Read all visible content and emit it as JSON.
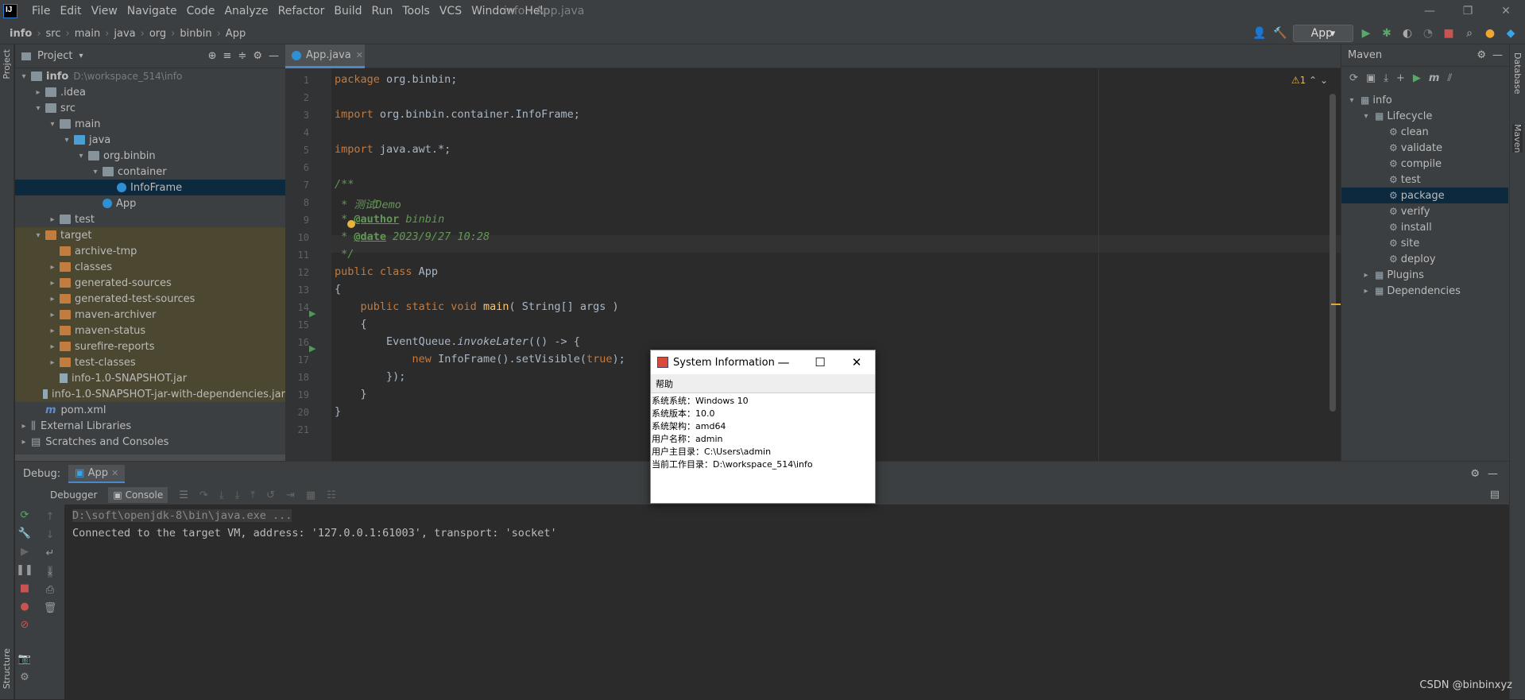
{
  "menubar": {
    "items": [
      "File",
      "Edit",
      "View",
      "Navigate",
      "Code",
      "Analyze",
      "Refactor",
      "Build",
      "Run",
      "Tools",
      "VCS",
      "Window",
      "Help"
    ],
    "window_title": "info - App.java"
  },
  "breadcrumb": {
    "items": [
      "info",
      "src",
      "main",
      "java",
      "org",
      "binbin",
      "App"
    ]
  },
  "toolbar": {
    "run_config": "App"
  },
  "project": {
    "title": "Project",
    "tree": [
      {
        "label": "info",
        "path": "D:\\workspace_514\\info",
        "indent": 0,
        "arrow": "▾",
        "icon": "folder"
      },
      {
        "label": ".idea",
        "indent": 1,
        "arrow": "▸",
        "icon": "folder"
      },
      {
        "label": "src",
        "indent": 1,
        "arrow": "▾",
        "icon": "folder"
      },
      {
        "label": "main",
        "indent": 2,
        "arrow": "▾",
        "icon": "folder"
      },
      {
        "label": "java",
        "indent": 3,
        "arrow": "▾",
        "icon": "folder blue"
      },
      {
        "label": "org.binbin",
        "indent": 4,
        "arrow": "▾",
        "icon": "folder"
      },
      {
        "label": "container",
        "indent": 5,
        "arrow": "▾",
        "icon": "folder"
      },
      {
        "label": "InfoFrame",
        "indent": 6,
        "arrow": "",
        "icon": "classic",
        "selected": true
      },
      {
        "label": "App",
        "indent": 5,
        "arrow": "",
        "icon": "classic"
      },
      {
        "label": "test",
        "indent": 2,
        "arrow": "▸",
        "icon": "folder"
      },
      {
        "label": "target",
        "indent": 1,
        "arrow": "▾",
        "icon": "folder orange",
        "target": true
      },
      {
        "label": "archive-tmp",
        "indent": 2,
        "arrow": "",
        "icon": "folder orange",
        "target": true
      },
      {
        "label": "classes",
        "indent": 2,
        "arrow": "▸",
        "icon": "folder orange",
        "target": true
      },
      {
        "label": "generated-sources",
        "indent": 2,
        "arrow": "▸",
        "icon": "folder orange",
        "target": true
      },
      {
        "label": "generated-test-sources",
        "indent": 2,
        "arrow": "▸",
        "icon": "folder orange",
        "target": true
      },
      {
        "label": "maven-archiver",
        "indent": 2,
        "arrow": "▸",
        "icon": "folder orange",
        "target": true
      },
      {
        "label": "maven-status",
        "indent": 2,
        "arrow": "▸",
        "icon": "folder orange",
        "target": true
      },
      {
        "label": "surefire-reports",
        "indent": 2,
        "arrow": "▸",
        "icon": "folder orange",
        "target": true
      },
      {
        "label": "test-classes",
        "indent": 2,
        "arrow": "▸",
        "icon": "folder orange",
        "target": true
      },
      {
        "label": "info-1.0-SNAPSHOT.jar",
        "indent": 2,
        "arrow": "",
        "icon": "jar",
        "target": true
      },
      {
        "label": "info-1.0-SNAPSHOT-jar-with-dependencies.jar",
        "indent": 2,
        "arrow": "",
        "icon": "jar",
        "target": true
      },
      {
        "label": "pom.xml",
        "indent": 1,
        "arrow": "",
        "icon": "mfile"
      },
      {
        "label": "External Libraries",
        "indent": 0,
        "arrow": "▸",
        "icon": "lib"
      },
      {
        "label": "Scratches and Consoles",
        "indent": 0,
        "arrow": "▸",
        "icon": "scratch"
      }
    ]
  },
  "editor": {
    "tab": "App.java",
    "warning": "⚠1",
    "lines": [
      "<span class=\"kw\">package</span> org.binbin;",
      "",
      "<span class=\"kw\">import</span> org.binbin.container.InfoFrame;",
      "",
      "<span class=\"kw\">import</span> java.awt.*;",
      "",
      "<span class=\"cm\">/**</span>",
      "<span class=\"cm\"> * 测试Demo</span>",
      "<span class=\"cm\"> * </span><span class=\"tag\">@author</span><span class=\"cm\"> binbin</span>",
      "<span class=\"cm\"> * </span><span class=\"tag\">@date</span><span class=\"cm\"> 2023/9/27 10:28</span>",
      "<span class=\"cm\"> */</span>",
      "<span class=\"kw\">public class</span> App",
      "{",
      "    <span class=\"kw\">public static void</span> <span class=\"fn\">main</span>( String[] args )",
      "    {",
      "        EventQueue.<span class=\"it\">invokeLater</span>(() -> {",
      "            <span class=\"kw\">new</span> InfoFrame().setVisible(<span class=\"kw\">true</span>);",
      "        });",
      "    }",
      "}",
      ""
    ]
  },
  "maven": {
    "title": "Maven",
    "items": [
      {
        "label": "info",
        "indent": 0,
        "arrow": "▾"
      },
      {
        "label": "Lifecycle",
        "indent": 1,
        "arrow": "▾"
      },
      {
        "label": "clean",
        "indent": 2,
        "arrow": ""
      },
      {
        "label": "validate",
        "indent": 2,
        "arrow": ""
      },
      {
        "label": "compile",
        "indent": 2,
        "arrow": ""
      },
      {
        "label": "test",
        "indent": 2,
        "arrow": ""
      },
      {
        "label": "package",
        "indent": 2,
        "arrow": "",
        "selected": true
      },
      {
        "label": "verify",
        "indent": 2,
        "arrow": ""
      },
      {
        "label": "install",
        "indent": 2,
        "arrow": ""
      },
      {
        "label": "site",
        "indent": 2,
        "arrow": ""
      },
      {
        "label": "deploy",
        "indent": 2,
        "arrow": ""
      },
      {
        "label": "Plugins",
        "indent": 1,
        "arrow": "▸"
      },
      {
        "label": "Dependencies",
        "indent": 1,
        "arrow": "▸"
      }
    ]
  },
  "strips": {
    "left_top": "Project",
    "left_bottom": "Structure",
    "right_1": "Database",
    "right_2": "Maven"
  },
  "debug": {
    "label": "Debug:",
    "session": "App",
    "tabs": [
      "Debugger",
      "Console"
    ],
    "console_lines": [
      "D:\\soft\\openjdk-8\\bin\\java.exe ...",
      "Connected to the target VM, address: '127.0.0.1:61003', transport: 'socket'"
    ]
  },
  "dialog": {
    "title": "System Information",
    "menu": "帮助",
    "lines": [
      "系统系统：Windows 10",
      "系统版本：10.0",
      "系统架构：amd64",
      "用户名称：admin",
      "用户主目录：C:\\Users\\admin",
      "当前工作目录：D:\\workspace_514\\info"
    ]
  },
  "watermark": "CSDN @binbinxyz"
}
